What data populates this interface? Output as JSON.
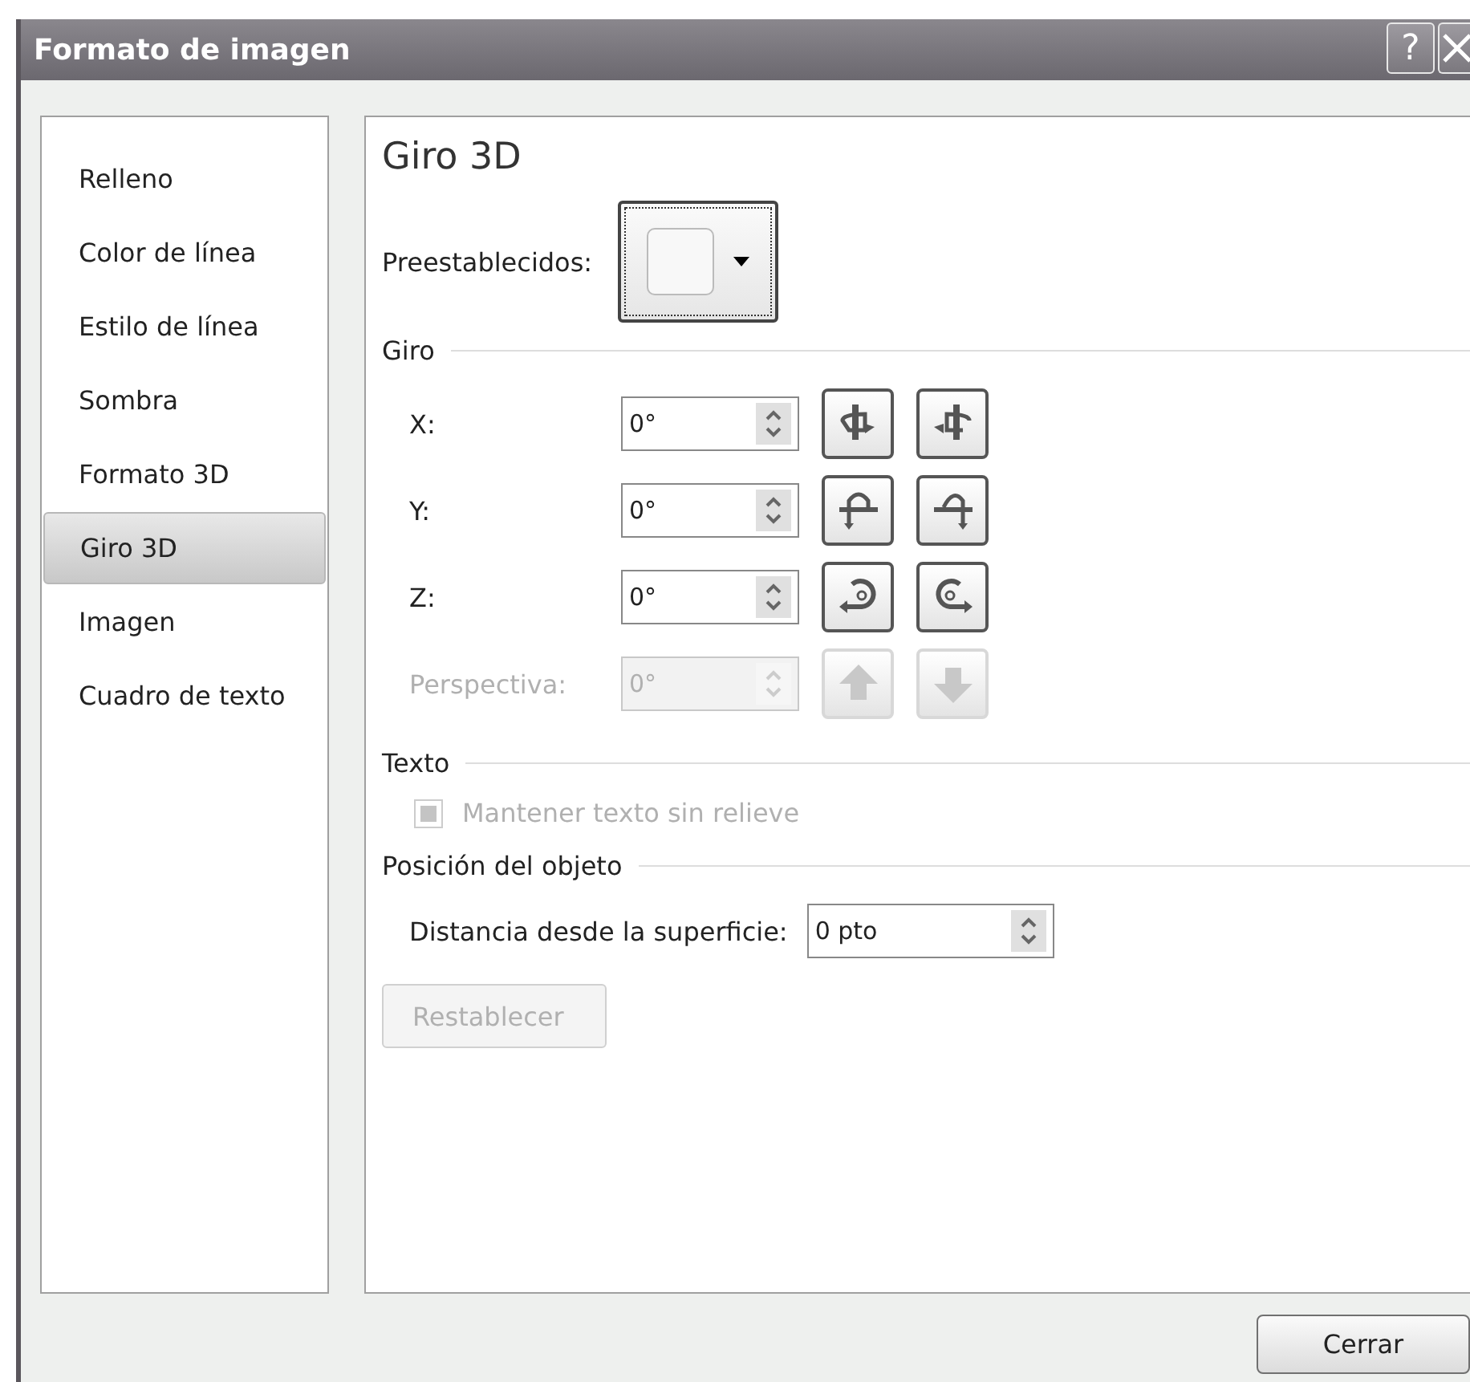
{
  "window": {
    "title": "Formato de imagen",
    "help_label": "?"
  },
  "sidebar": {
    "items": [
      {
        "label": "Relleno",
        "selected": false
      },
      {
        "label": "Color de línea",
        "selected": false
      },
      {
        "label": "Estilo de línea",
        "selected": false
      },
      {
        "label": "Sombra",
        "selected": false
      },
      {
        "label": "Formato 3D",
        "selected": false
      },
      {
        "label": "Giro 3D",
        "selected": true
      },
      {
        "label": "Imagen",
        "selected": false
      },
      {
        "label": "Cuadro de texto",
        "selected": false
      }
    ]
  },
  "panel": {
    "title": "Giro 3D",
    "presets_label": "Preestablecidos:",
    "rotation": {
      "heading": "Giro",
      "rows": [
        {
          "label": "X:",
          "value": "0°",
          "disabled": false
        },
        {
          "label": "Y:",
          "value": "0°",
          "disabled": false
        },
        {
          "label": "Z:",
          "value": "0°",
          "disabled": false
        },
        {
          "label": "Perspectiva:",
          "value": "0°",
          "disabled": true
        }
      ]
    },
    "text": {
      "heading": "Texto",
      "checkbox": {
        "label": "Mantener texto sin relieve",
        "checked": true,
        "disabled": true
      }
    },
    "position": {
      "heading": "Posición del objeto",
      "distance_label": "Distancia desde la superficie:",
      "distance_value": "0 pto"
    },
    "reset_button": {
      "label": "Restablecer",
      "disabled": true
    }
  },
  "buttons": [
    {
      "label": "Cerrar"
    }
  ]
}
